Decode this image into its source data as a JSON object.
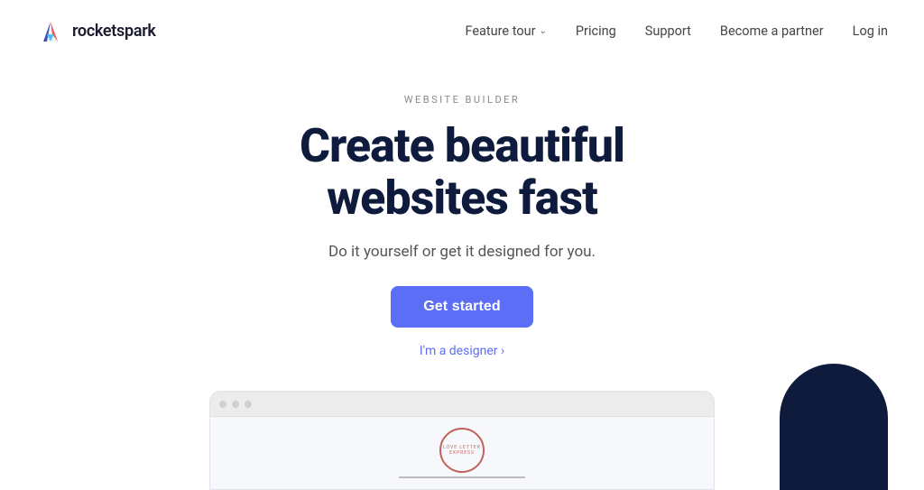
{
  "logo": {
    "text": "rocketspark"
  },
  "navbar": {
    "feature_tour_label": "Feature tour",
    "pricing_label": "Pricing",
    "support_label": "Support",
    "partner_label": "Become a partner",
    "login_label": "Log in"
  },
  "hero": {
    "eyebrow": "WEBSITE BUILDER",
    "title_line1": "Create beautiful",
    "title_line2": "websites fast",
    "subtitle": "Do it yourself or get it designed for you.",
    "cta_label": "Get started",
    "designer_link": "I'm a designer ›"
  },
  "preview": {
    "stamp_text": "Love Letter Express"
  },
  "icons": {
    "chevron": "∨"
  }
}
